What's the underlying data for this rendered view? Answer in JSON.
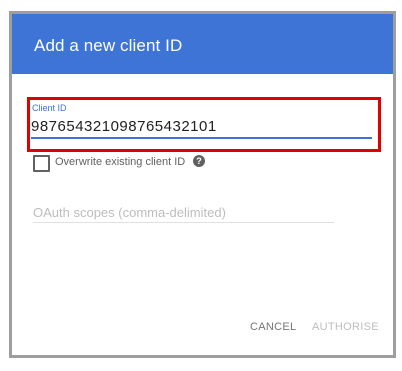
{
  "dialog": {
    "title": "Add a new client ID",
    "accent_color": "#3d74d6",
    "highlight_color": "#e00000"
  },
  "client_id": {
    "label": "Client ID",
    "value": "987654321098765432101"
  },
  "overwrite": {
    "label": "Overwrite existing client ID",
    "checked": false,
    "help_icon": "?"
  },
  "scopes": {
    "placeholder": "OAuth scopes (comma-delimited)",
    "value": ""
  },
  "actions": {
    "cancel_label": "CANCEL",
    "authorise_label": "AUTHORISE"
  }
}
